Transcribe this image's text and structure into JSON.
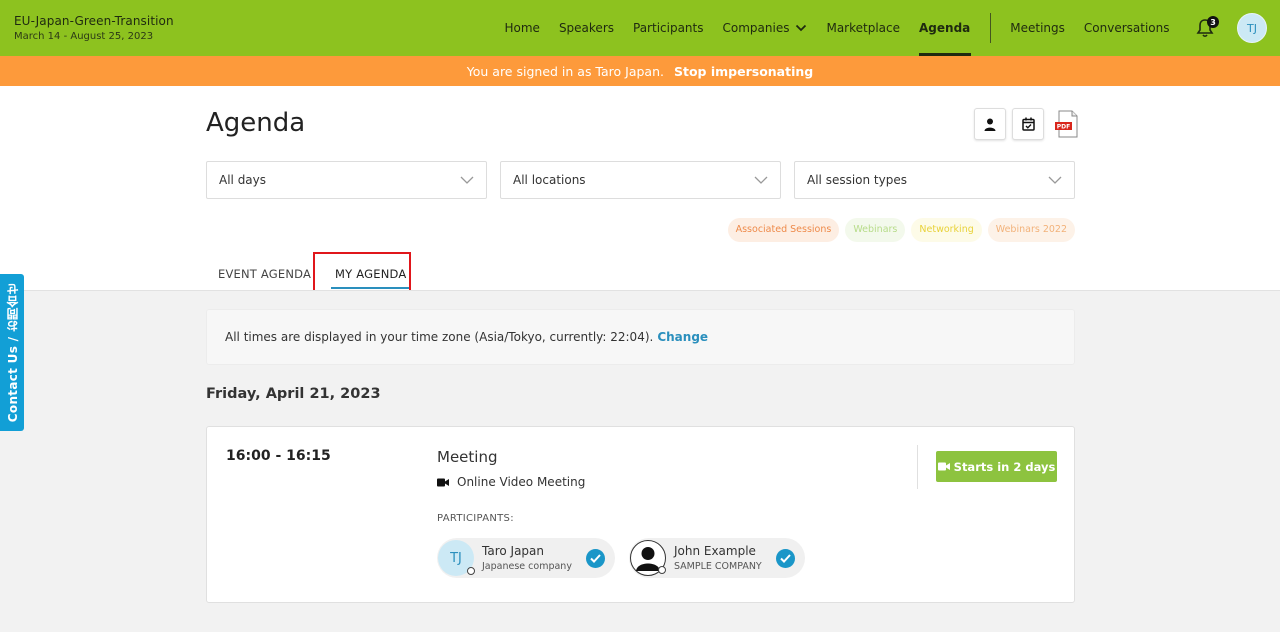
{
  "header": {
    "brand_title": "EU-Japan-Green-Transition",
    "brand_dates": "March 14 - August 25, 2023",
    "nav": [
      {
        "label": "Home"
      },
      {
        "label": "Speakers"
      },
      {
        "label": "Participants"
      },
      {
        "label": "Companies"
      },
      {
        "label": "Marketplace"
      },
      {
        "label": "Agenda"
      }
    ],
    "nav_right": [
      {
        "label": "Meetings"
      },
      {
        "label": "Conversations"
      }
    ],
    "active_nav": "Agenda",
    "notification_count": "3",
    "avatar_initials": "TJ",
    "colors": {
      "header_bg": "#8dc21f",
      "banner_bg": "#fd9a3b",
      "accent": "#2a8fbd"
    }
  },
  "impersonation": {
    "message": "You are signed in as Taro Japan.",
    "stop_label": "Stop impersonating"
  },
  "page": {
    "title": "Agenda"
  },
  "filters": {
    "days": "All days",
    "locations": "All locations",
    "session_types": "All session types"
  },
  "chips": [
    {
      "label": "Associated Sessions",
      "color": "#ee8a4a",
      "bg": "#fdeee3"
    },
    {
      "label": "Webinars",
      "color": "#b7dc8a",
      "bg": "#f3f9ec"
    },
    {
      "label": "Networking",
      "color": "#e8d23a",
      "bg": "#fdfbe8"
    },
    {
      "label": "Webinars 2022",
      "color": "#f2b27a",
      "bg": "#fdf2e8"
    }
  ],
  "tabs": [
    {
      "label": "EVENT AGENDA"
    },
    {
      "label": "MY AGENDA"
    }
  ],
  "timezone": {
    "text": "All times are displayed in your time zone (Asia/Tokyo, currently: 22:04).",
    "change_label": "Change"
  },
  "day_heading": "Friday, April 21, 2023",
  "meeting": {
    "time": "16:00 - 16:15",
    "title": "Meeting",
    "type": "Online Video Meeting",
    "participants_label": "PARTICIPANTS:",
    "participants": [
      {
        "initials": "TJ",
        "name": "Taro Japan",
        "company": "Japanese company"
      },
      {
        "initials": "",
        "name": "John Example",
        "company": "SAMPLE COMPANY"
      }
    ],
    "start_label": "Starts in 2 days"
  },
  "contact_tab": "Contact Us / お問合せ"
}
